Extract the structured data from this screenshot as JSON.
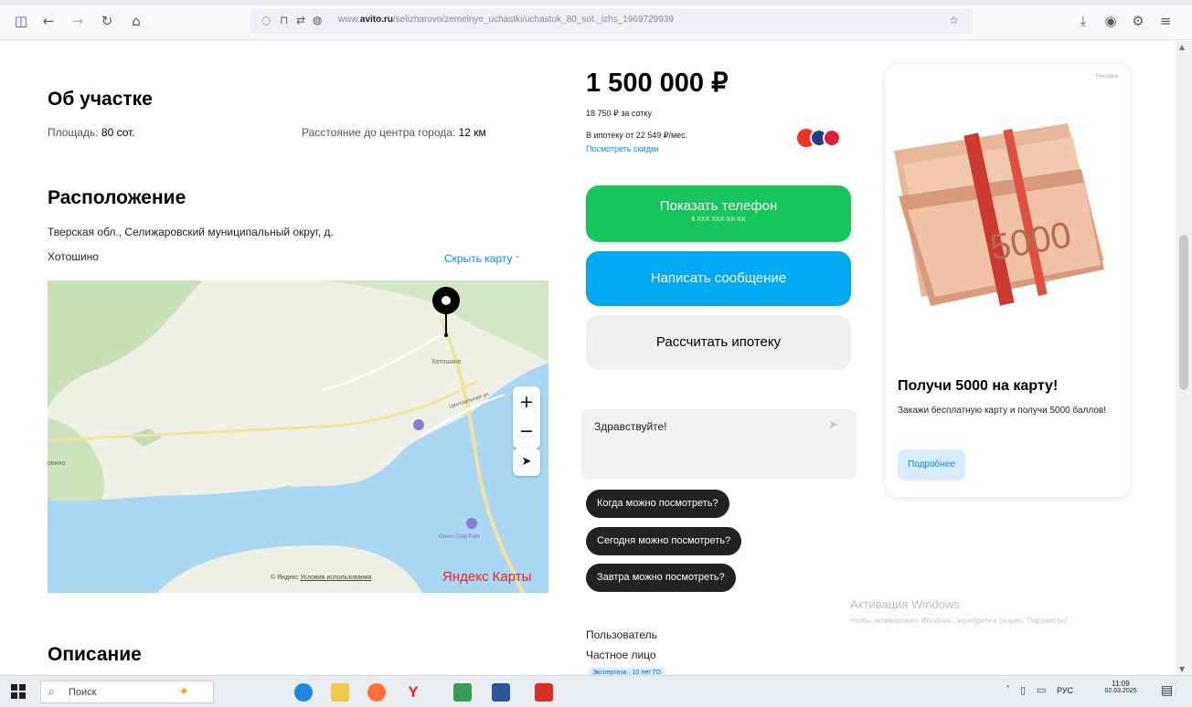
{
  "browser": {
    "url_prefix": "www.",
    "url_domain": "avito.ru",
    "url_path": "/selizharovo/zemelnye_uchastki/uchastok_80_sot._izhs_1969729939"
  },
  "plot_section": {
    "title": "Об участке",
    "area_label": "Площадь:",
    "area_value": "80 сот.",
    "distance_label": "Расстояние до центра города:",
    "distance_value": "12 км"
  },
  "location": {
    "title": "Расположение",
    "address_line1": "Тверская обл., Селижаровский муниципальный округ, д.",
    "address_line2": "Хотошино",
    "hide_map_link": "Скрыть карту",
    "map_village_label": "Хотошино",
    "map_street_label": "Центральная ул.",
    "map_left_label": "овино",
    "map_poi_label": "Green Gold Park",
    "map_copyright": "© Яндекс",
    "map_terms_link": "Условия использования",
    "map_brand": "Яндекс Карты",
    "map_zoom_in": "+",
    "map_zoom_out": "−"
  },
  "description": {
    "title": "Описание"
  },
  "offer": {
    "price": "1 500 000 ₽",
    "price_per_unit": "18 750 ₽ за сотку",
    "mortgage_text": "В ипотеку от 22 549 ₽/мес.",
    "mortgage_link": "Посмотреть скидки",
    "phone_button": "Показать телефон",
    "phone_masked": "8 XXX XXX-XX-XX",
    "message_button": "Написать сообщение",
    "mortgage_button": "Рассчитать ипотеку"
  },
  "chat": {
    "greeting": "Здравствуйте!",
    "quick_replies": [
      "Когда можно посмотреть?",
      "Сегодня можно посмотреть?",
      "Завтра можно посмотреть?"
    ]
  },
  "seller": {
    "name": "Пользователь",
    "type": "Частное лицо",
    "badge": "Экспертиза · 10 лет ГО"
  },
  "ad": {
    "label": "Реклама",
    "banknote_text": "5000",
    "title": "Получи 5000 на карту!",
    "text": "Закажи бесплатную карту и получи 5000 баллов!",
    "button": "Подробнее"
  },
  "windows_watermark": {
    "title": "Активация Windows",
    "text": "Чтобы активировать Windows, перейдите в раздел \"Параметры\"."
  },
  "taskbar": {
    "search_placeholder": "Поиск",
    "lang": "РУС",
    "time": "11:09",
    "date": "02.03.2025"
  },
  "colors": {
    "green_button": "#16c65c",
    "blue_button": "#00a9f2",
    "link_blue": "#0a8cff",
    "water": "#a9d7f2",
    "forest": "#c8e0b8"
  }
}
